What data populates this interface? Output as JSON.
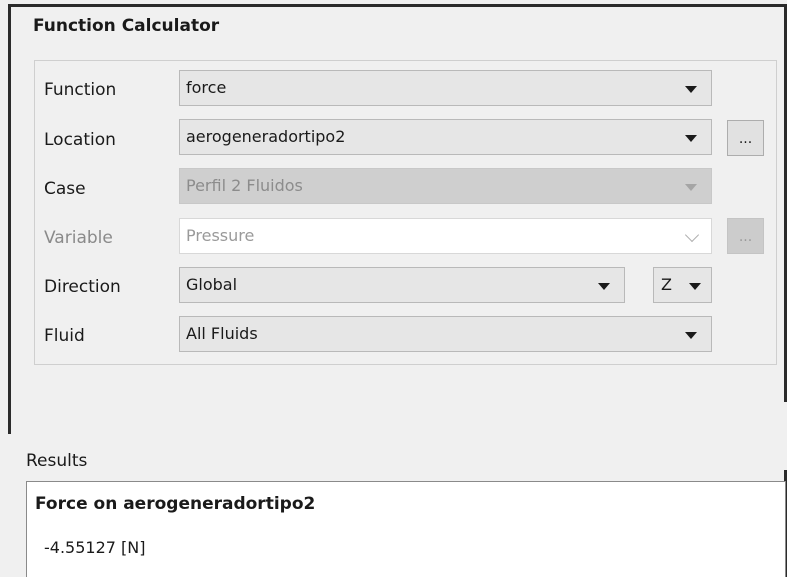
{
  "panel": {
    "title": "Function Calculator"
  },
  "form": {
    "function": {
      "label": "Function",
      "value": "force"
    },
    "location": {
      "label": "Location",
      "value": "aerogeneradortipo2",
      "browse_label": "..."
    },
    "case": {
      "label": "Case",
      "value": "Perfil 2 Fluidos"
    },
    "variable": {
      "label": "Variable",
      "value": "Pressure",
      "browse_label": "..."
    },
    "direction": {
      "label": "Direction",
      "value": "Global",
      "axis": "Z"
    },
    "fluid": {
      "label": "Fluid",
      "value": "All Fluids"
    }
  },
  "results": {
    "label": "Results",
    "title": "Force on aerogeneradortipo2",
    "value": "-4.55127 [N]"
  },
  "icons": {
    "dropdown": "chevron-down-icon",
    "browse": "ellipsis-icon"
  }
}
